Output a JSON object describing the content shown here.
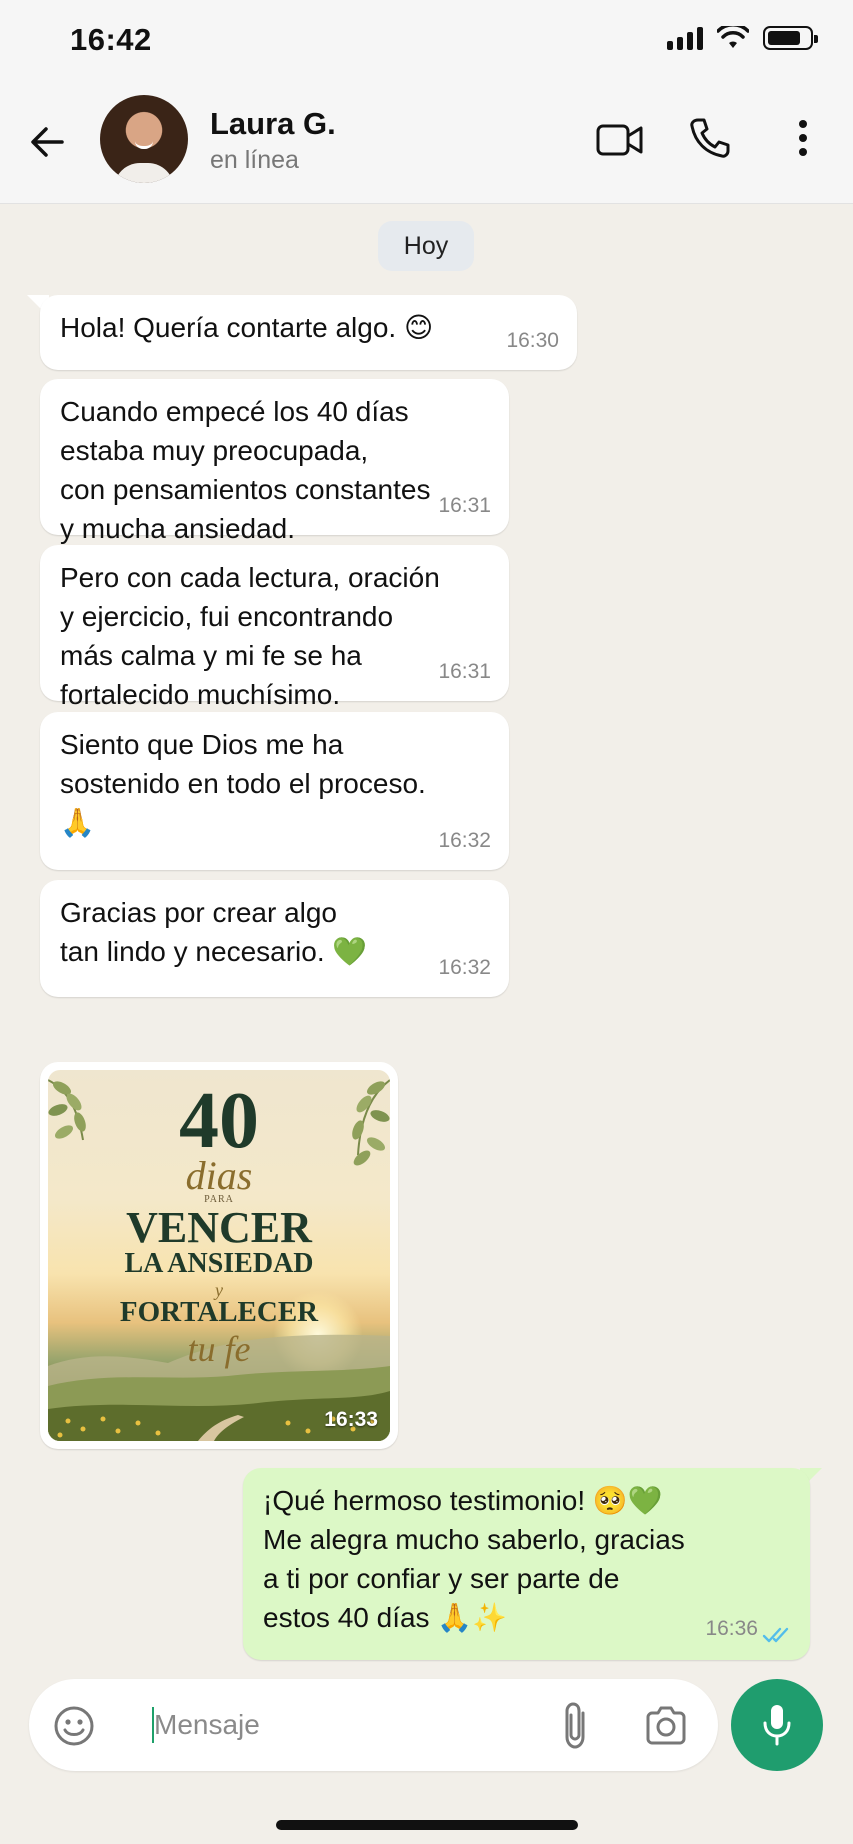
{
  "status_bar": {
    "time": "16:42"
  },
  "header": {
    "contact_name": "Laura G.",
    "contact_status": "en línea"
  },
  "chat": {
    "date_chip": "Hoy",
    "messages": [
      {
        "direction": "in",
        "text": "Hola! Quería contarte algo. 😊",
        "time": "16:30"
      },
      {
        "direction": "in",
        "text": "Cuando empecé los 40 días\nestaba muy preocupada,\ncon pensamientos constantes\ny mucha ansiedad.",
        "time": "16:31"
      },
      {
        "direction": "in",
        "text": "Pero con cada lectura, oración\ny ejercicio, fui encontrando\nmás calma y mi fe se ha\nfortalecido muchísimo.",
        "time": "16:31"
      },
      {
        "direction": "in",
        "text": "Siento que Dios me ha\nsostenido en todo el proceso.\n🙏",
        "time": "16:32"
      },
      {
        "direction": "in",
        "text": "Gracias por crear algo\ntan lindo y necesario. 💚",
        "time": "16:32"
      },
      {
        "direction": "out",
        "text": "¡Qué hermoso testimonio! 🥺💚\nMe alegra mucho saberlo, gracias\na ti por confiar y ser parte de\nestos 40 días 🙏✨",
        "time": "16:36",
        "status": "read"
      }
    ],
    "image_message": {
      "time": "16:33",
      "cover": {
        "number": "40",
        "dias": "dias",
        "para": "PARA",
        "vencer": "VENCER",
        "ansiedad": "LA ANSIEDAD",
        "y": "y",
        "fortalecer": "FORTALECER",
        "tu_fe": "tu fe"
      }
    }
  },
  "input_bar": {
    "placeholder": "Mensaje"
  },
  "colors": {
    "accent": "#1f9d6e",
    "outgoing_bubble": "#dcf8c6",
    "incoming_bubble": "#ffffff",
    "read_ticks": "#53bdeb"
  },
  "icons": [
    "back-arrow-icon",
    "video-call-icon",
    "phone-icon",
    "more-vert-icon",
    "emoji-icon",
    "attach-icon",
    "camera-icon",
    "mic-icon",
    "double-check-icon"
  ]
}
